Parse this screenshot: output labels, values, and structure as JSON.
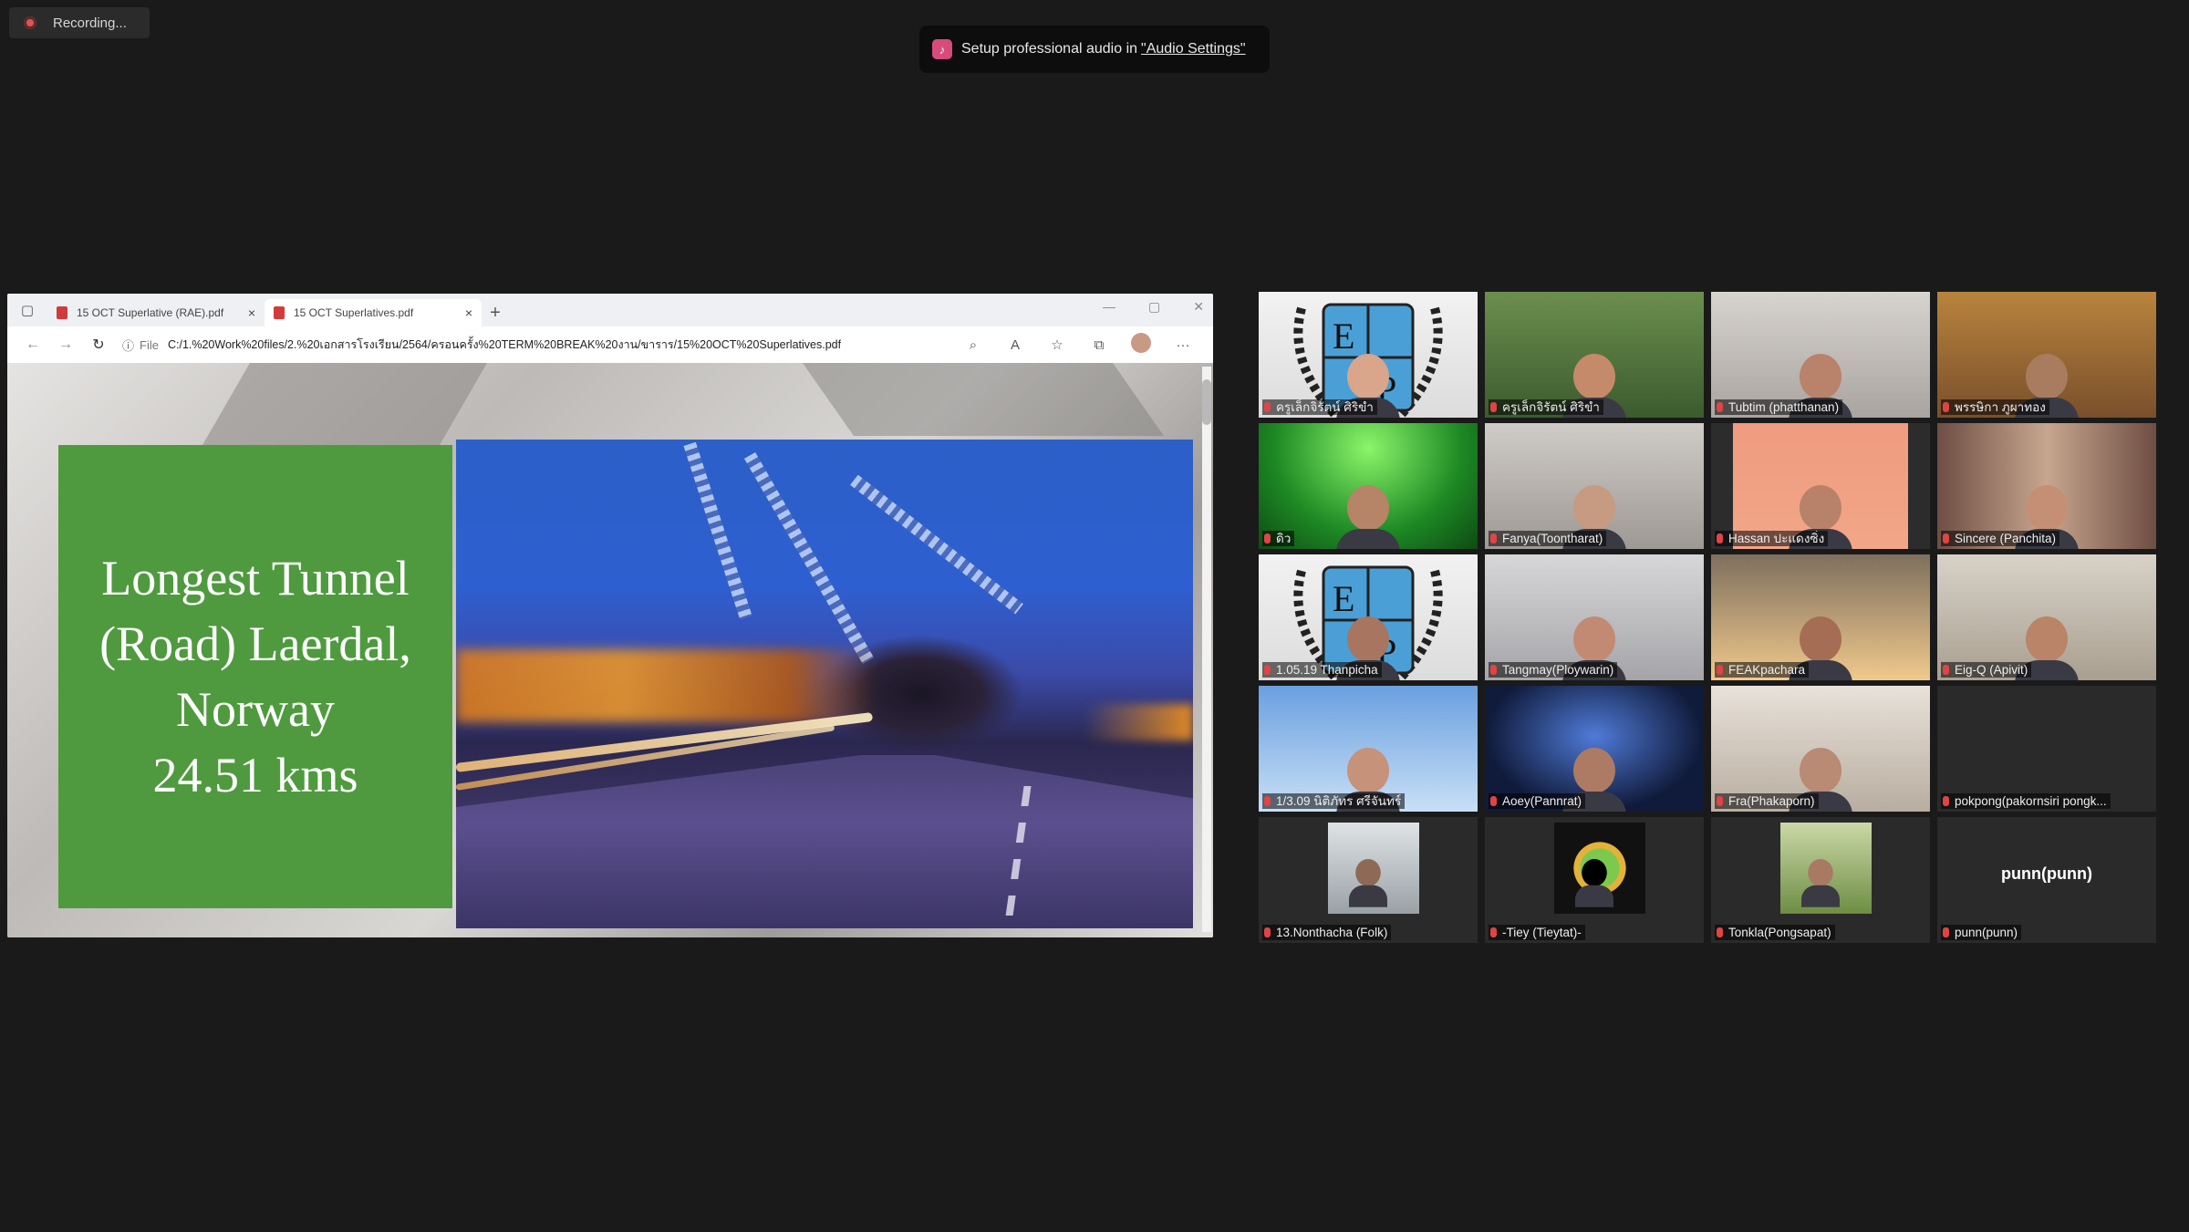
{
  "recording": {
    "label": "Recording..."
  },
  "toast": {
    "text": "Setup professional audio in",
    "link": "\"Audio Settings\""
  },
  "browser": {
    "tabs": [
      {
        "label": "15 OCT Superlative (RAE).pdf",
        "close": "×"
      },
      {
        "label": "15 OCT Superlatives.pdf",
        "close": "×"
      }
    ],
    "new_tab": "+",
    "address": {
      "scheme_label": "File",
      "url": "C:/1.%20Work%20files/2.%20เอกสารโรงเรียน/2564/ครอนครั้ง%20TERM%20BREAK%20งาน/ขาราร/15%20OCT%20Superlatives.pdf"
    }
  },
  "slide": {
    "title_lines": [
      "Longest Tunnel",
      "(Road) Laerdal,",
      "Norway",
      "24.51 kms"
    ]
  },
  "participants": [
    {
      "name": "ครูเล็กจิรัตน์ ศิริขำ"
    },
    {
      "name": "ครูเล็กจิรัตน์ ศิริขำ"
    },
    {
      "name": "Tubtim (phatthanan)"
    },
    {
      "name": "พรรษิกา ภูผาทอง"
    },
    {
      "name": "ดิว"
    },
    {
      "name": "Fanya(Toontharat)"
    },
    {
      "name": "Hassan ปะแดงซิ่ง"
    },
    {
      "name": "Sincere (Panchita)"
    },
    {
      "name": "1.05.19 Thanpicha"
    },
    {
      "name": "Tangmay(Ploywarin)"
    },
    {
      "name": "FEAKpachara"
    },
    {
      "name": "Eig-Q (Apivit)"
    },
    {
      "name": "1/3.09 นิติภัทร ศรีจันทร์"
    },
    {
      "name": "Aoey(Pannrat)"
    },
    {
      "name": "Fra(Phakaporn)"
    },
    {
      "name": "pokpong(pakornsiri pongk..."
    },
    {
      "name": "13.Nonthacha (Folk)"
    },
    {
      "name": "-Tiey (Tieytat)-"
    },
    {
      "name": "Tonkla(Pongsapat)"
    },
    {
      "name": "punn(punn)",
      "big_label": "punn(punn)"
    }
  ],
  "colors": {
    "background": "#1a1a1a",
    "slide_green": "#4f9a3e",
    "active_speaker": "#c9d76a",
    "muted_mic": "#e04444"
  }
}
